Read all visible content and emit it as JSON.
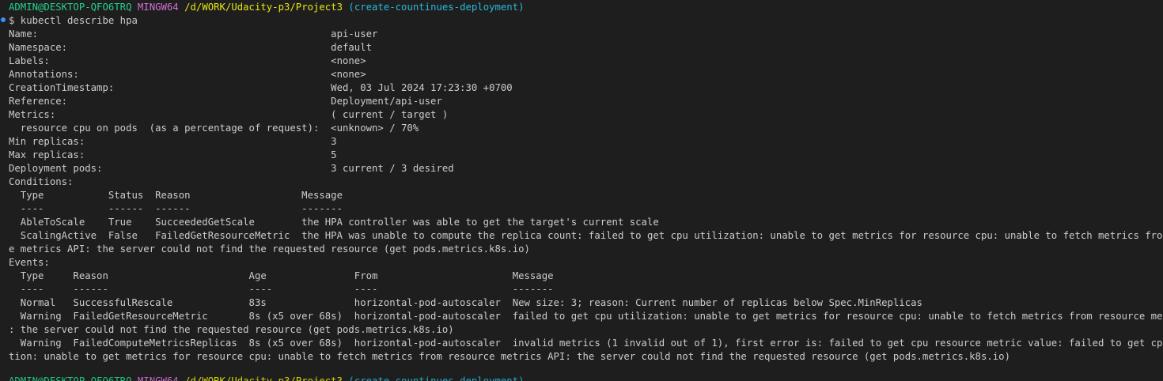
{
  "colors": {
    "background": "#1e1e1e",
    "text": "#cccccc",
    "user": "#23d18b",
    "msystem": "#d670d6",
    "path": "#e5e510",
    "branch": "#29b8db",
    "command_marker": "#3794ff"
  },
  "prompt": {
    "user_host": "ADMIN@DESKTOP-QFO6TRQ",
    "msystem": "MINGW64",
    "path": "/d/WORK/Udacity-p3/Project3",
    "branch": "(create-countinues-deployment)"
  },
  "command": "$ kubectl describe hpa",
  "output_lines": [
    "Name:                                                  api-user",
    "Namespace:                                             default",
    "Labels:                                                <none>",
    "Annotations:                                           <none>",
    "CreationTimestamp:                                     Wed, 03 Jul 2024 17:23:30 +0700",
    "Reference:                                             Deployment/api-user",
    "Metrics:                                               ( current / target )",
    "  resource cpu on pods  (as a percentage of request):  <unknown> / 70%",
    "Min replicas:                                          3",
    "Max replicas:                                          5",
    "Deployment pods:                                       3 current / 3 desired",
    "Conditions:",
    "  Type           Status  Reason                   Message",
    "  ----           ------  ------                   -------",
    "  AbleToScale    True    SucceededGetScale        the HPA controller was able to get the target's current scale",
    "  ScalingActive  False   FailedGetResourceMetric  the HPA was unable to compute the replica count: failed to get cpu utilization: unable to get metrics for resource cpu: unable to fetch metrics from resourc",
    "e metrics API: the server could not find the requested resource (get pods.metrics.k8s.io)",
    "Events:",
    "  Type     Reason                        Age               From                       Message",
    "  ----     ------                        ----              ----                       -------",
    "  Normal   SuccessfulRescale             83s               horizontal-pod-autoscaler  New size: 3; reason: Current number of replicas below Spec.MinReplicas",
    "  Warning  FailedGetResourceMetric       8s (x5 over 68s)  horizontal-pod-autoscaler  failed to get cpu utilization: unable to get metrics for resource cpu: unable to fetch metrics from resource metrics API",
    ": the server could not find the requested resource (get pods.metrics.k8s.io)",
    "  Warning  FailedComputeMetricsReplicas  8s (x5 over 68s)  horizontal-pod-autoscaler  invalid metrics (1 invalid out of 1), first error is: failed to get cpu resource metric value: failed to get cpu utiliza",
    "tion: unable to get metrics for resource cpu: unable to fetch metrics from resource metrics API: the server could not find the requested resource (get pods.metrics.k8s.io)"
  ]
}
